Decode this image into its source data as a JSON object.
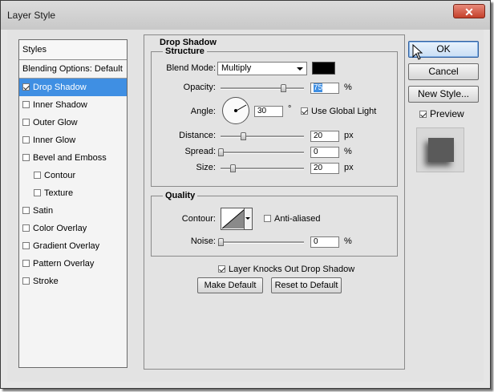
{
  "window": {
    "title": "Layer Style",
    "close_icon": "close-icon"
  },
  "sidebar": {
    "header": "Styles",
    "items": [
      {
        "label": "Blending Options: Default",
        "has_checkbox": false,
        "checked": false,
        "indent": false,
        "selected": false
      },
      {
        "label": "Drop Shadow",
        "has_checkbox": true,
        "checked": true,
        "indent": false,
        "selected": true
      },
      {
        "label": "Inner Shadow",
        "has_checkbox": true,
        "checked": false,
        "indent": false,
        "selected": false
      },
      {
        "label": "Outer Glow",
        "has_checkbox": true,
        "checked": false,
        "indent": false,
        "selected": false
      },
      {
        "label": "Inner Glow",
        "has_checkbox": true,
        "checked": false,
        "indent": false,
        "selected": false
      },
      {
        "label": "Bevel and Emboss",
        "has_checkbox": true,
        "checked": false,
        "indent": false,
        "selected": false
      },
      {
        "label": "Contour",
        "has_checkbox": true,
        "checked": false,
        "indent": true,
        "selected": false
      },
      {
        "label": "Texture",
        "has_checkbox": true,
        "checked": false,
        "indent": true,
        "selected": false
      },
      {
        "label": "Satin",
        "has_checkbox": true,
        "checked": false,
        "indent": false,
        "selected": false
      },
      {
        "label": "Color Overlay",
        "has_checkbox": true,
        "checked": false,
        "indent": false,
        "selected": false
      },
      {
        "label": "Gradient Overlay",
        "has_checkbox": true,
        "checked": false,
        "indent": false,
        "selected": false
      },
      {
        "label": "Pattern Overlay",
        "has_checkbox": true,
        "checked": false,
        "indent": false,
        "selected": false
      },
      {
        "label": "Stroke",
        "has_checkbox": true,
        "checked": false,
        "indent": false,
        "selected": false
      }
    ]
  },
  "drop_shadow": {
    "title": "Drop Shadow",
    "structure": {
      "title": "Structure",
      "blend_mode_label": "Blend Mode:",
      "blend_mode_value": "Multiply",
      "color": "#000000",
      "opacity_label": "Opacity:",
      "opacity_value": "75",
      "opacity_unit": "%",
      "opacity_fraction": 0.75,
      "angle_label": "Angle:",
      "angle_value": "30",
      "angle_unit": "°",
      "use_global_light_label": "Use Global Light",
      "use_global_light_checked": true,
      "distance_label": "Distance:",
      "distance_value": "20",
      "distance_unit": "px",
      "distance_fraction": 0.27,
      "spread_label": "Spread:",
      "spread_value": "0",
      "spread_unit": "%",
      "spread_fraction": 0.0,
      "size_label": "Size:",
      "size_value": "20",
      "size_unit": "px",
      "size_fraction": 0.14
    },
    "quality": {
      "title": "Quality",
      "contour_label": "Contour:",
      "anti_aliased_label": "Anti-aliased",
      "anti_aliased_checked": false,
      "noise_label": "Noise:",
      "noise_value": "0",
      "noise_unit": "%",
      "noise_fraction": 0.0
    },
    "layer_knocks_out_label": "Layer Knocks Out Drop Shadow",
    "layer_knocks_out_checked": true,
    "make_default_label": "Make Default",
    "reset_to_default_label": "Reset to Default"
  },
  "buttons": {
    "ok": "OK",
    "cancel": "Cancel",
    "new_style": "New Style..."
  },
  "preview": {
    "label": "Preview",
    "checked": true
  }
}
